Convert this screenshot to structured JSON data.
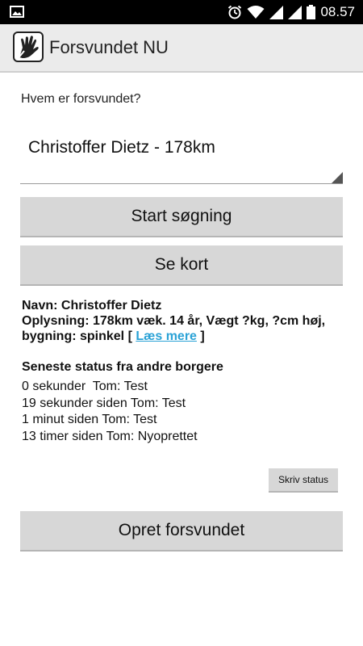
{
  "status_bar": {
    "time": "08.57",
    "icons": [
      "image-icon",
      "alarm-icon",
      "wifi-icon",
      "signal-icon",
      "signal-icon",
      "battery-icon"
    ]
  },
  "app_bar": {
    "title": "Forsvundet NU",
    "icon": "hand-logo-icon"
  },
  "form": {
    "question_label": "Hvem er forsvundet?",
    "selected_person": "Christoffer Dietz - 178km"
  },
  "buttons": {
    "start_search": "Start søgning",
    "see_map": "Se kort",
    "write_status": "Skriv status",
    "create_missing": "Opret forsvundet"
  },
  "person_info": {
    "name_line": "Navn: Christoffer Dietz",
    "info_line": "Oplysning: 178km væk. 14 år, Vægt ?kg, ?cm høj, bygning: spinkel [ ",
    "read_more": "Læs mere",
    "info_close": " ]"
  },
  "status": {
    "heading": "Seneste status fra andre borgere",
    "entries": [
      "0 sekunder  Tom: Test",
      "19 sekunder siden Tom: Test",
      "1 minut siden Tom: Test",
      "13 timer siden Tom: Nyoprettet"
    ]
  },
  "colors": {
    "link": "#2aa2d6",
    "button_bg": "#d7d7d7",
    "app_bar_bg": "#ebebeb"
  }
}
